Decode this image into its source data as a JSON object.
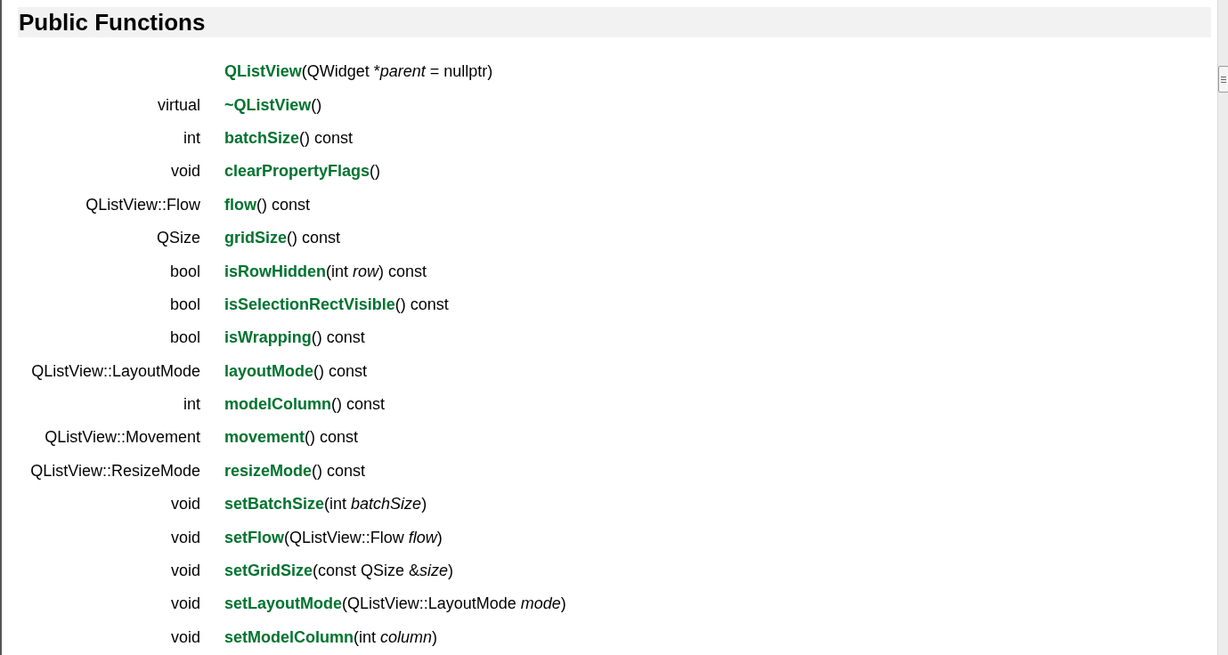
{
  "heading": "Public Functions",
  "functions": [
    {
      "name": "QListView",
      "args": [
        {
          "text": "(QWidget *",
          "italic": false
        },
        {
          "text": "parent",
          "italic": true
        },
        {
          "text": " = nullptr)",
          "italic": false
        }
      ]
    },
    {
      "type": "virtual",
      "name": "~QListView",
      "args": [
        {
          "text": "()",
          "italic": false
        }
      ]
    },
    {
      "type": "int",
      "name": "batchSize",
      "args": [
        {
          "text": "() const",
          "italic": false
        }
      ]
    },
    {
      "type": "void",
      "name": "clearPropertyFlags",
      "args": [
        {
          "text": "()",
          "italic": false
        }
      ]
    },
    {
      "type": "QListView::Flow",
      "name": "flow",
      "args": [
        {
          "text": "() const",
          "italic": false
        }
      ]
    },
    {
      "type": "QSize",
      "name": "gridSize",
      "args": [
        {
          "text": "() const",
          "italic": false
        }
      ]
    },
    {
      "type": "bool",
      "name": "isRowHidden",
      "args": [
        {
          "text": "(int ",
          "italic": false
        },
        {
          "text": "row",
          "italic": true
        },
        {
          "text": ") const",
          "italic": false
        }
      ]
    },
    {
      "type": "bool",
      "name": "isSelectionRectVisible",
      "args": [
        {
          "text": "() const",
          "italic": false
        }
      ]
    },
    {
      "type": "bool",
      "name": "isWrapping",
      "args": [
        {
          "text": "() const",
          "italic": false
        }
      ]
    },
    {
      "type": "QListView::LayoutMode",
      "name": "layoutMode",
      "args": [
        {
          "text": "() const",
          "italic": false
        }
      ]
    },
    {
      "type": "int",
      "name": "modelColumn",
      "args": [
        {
          "text": "() const",
          "italic": false
        }
      ]
    },
    {
      "type": "QListView::Movement",
      "name": "movement",
      "args": [
        {
          "text": "() const",
          "italic": false
        }
      ]
    },
    {
      "type": "QListView::ResizeMode",
      "name": "resizeMode",
      "args": [
        {
          "text": "() const",
          "italic": false
        }
      ]
    },
    {
      "type": "void",
      "name": "setBatchSize",
      "args": [
        {
          "text": "(int ",
          "italic": false
        },
        {
          "text": "batchSize",
          "italic": true
        },
        {
          "text": ")",
          "italic": false
        }
      ]
    },
    {
      "type": "void",
      "name": "setFlow",
      "args": [
        {
          "text": "(QListView::Flow ",
          "italic": false
        },
        {
          "text": "flow",
          "italic": true
        },
        {
          "text": ")",
          "italic": false
        }
      ]
    },
    {
      "type": "void",
      "name": "setGridSize",
      "args": [
        {
          "text": "(const QSize &",
          "italic": false
        },
        {
          "text": "size",
          "italic": true
        },
        {
          "text": ")",
          "italic": false
        }
      ]
    },
    {
      "type": "void",
      "name": "setLayoutMode",
      "args": [
        {
          "text": "(QListView::LayoutMode ",
          "italic": false
        },
        {
          "text": "mode",
          "italic": true
        },
        {
          "text": ")",
          "italic": false
        }
      ]
    },
    {
      "type": "void",
      "name": "setModelColumn",
      "args": [
        {
          "text": "(int ",
          "italic": false
        },
        {
          "text": "column",
          "italic": true
        },
        {
          "text": ")",
          "italic": false
        }
      ]
    }
  ]
}
